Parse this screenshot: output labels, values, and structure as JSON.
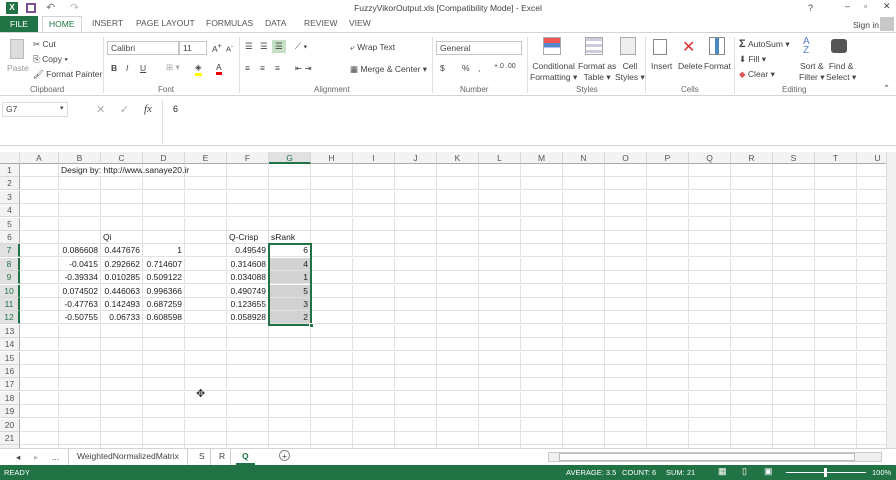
{
  "window": {
    "title": "FuzzyVikorOutput.xls  [Compatibility Mode] - Excel",
    "help": "?",
    "sign_in": "Sign in"
  },
  "tabs": [
    "FILE",
    "HOME",
    "INSERT",
    "PAGE LAYOUT",
    "FORMULAS",
    "DATA",
    "REVIEW",
    "VIEW"
  ],
  "ribbon": {
    "clipboard": {
      "paste": "Paste",
      "cut": "Cut",
      "copy": "Copy",
      "format_painter": "Format Painter",
      "label": "Clipboard"
    },
    "font": {
      "name": "Calibri",
      "size": "11",
      "bold": "B",
      "italic": "I",
      "underline": "U",
      "label": "Font"
    },
    "alignment": {
      "wrap": "Wrap Text",
      "merge": "Merge & Center",
      "label": "Alignment"
    },
    "number": {
      "format": "General",
      "currency": "$",
      "percent": "%",
      "comma": ",",
      "label": "Number"
    },
    "styles": {
      "conditional": "Conditional",
      "conditional2": "Formatting",
      "format_table": "Format as",
      "format_table2": "Table",
      "cell_styles": "Cell",
      "cell_styles2": "Styles",
      "label": "Styles"
    },
    "cells": {
      "insert": "Insert",
      "delete": "Delete",
      "format": "Format",
      "label": "Cells"
    },
    "editing": {
      "autosum": "AutoSum",
      "fill": "Fill",
      "clear": "Clear",
      "sort": "Sort &",
      "sort2": "Filter",
      "find": "Find &",
      "find2": "Select",
      "label": "Editing"
    }
  },
  "formula_bar": {
    "name_box": "G7",
    "fx": "fx",
    "value": "6"
  },
  "columns": [
    "A",
    "B",
    "C",
    "D",
    "E",
    "F",
    "G",
    "H",
    "I",
    "J",
    "K",
    "L",
    "M",
    "N",
    "O",
    "P",
    "Q",
    "R",
    "S",
    "T",
    "U"
  ],
  "row_count": 22,
  "cells": {
    "B1": "Design by: http://www.sanaye20.ir",
    "C6": "Qi",
    "F6": "Q-Crisp",
    "G6": "sRank",
    "B7": "0.086608",
    "C7": "0.447676",
    "D7": "1",
    "F7": "0.49549",
    "G7": "6",
    "B8": "-0.0415",
    "C8": "0.292662",
    "D8": "0.714607",
    "F8": "0.314608",
    "G8": "4",
    "B9": "-0.39334",
    "C9": "0.010285",
    "D9": "0.509122",
    "F9": "0.034088",
    "G9": "1",
    "B10": "0.074502",
    "C10": "0.446063",
    "D10": "0.996366",
    "F10": "0.490749",
    "G10": "5",
    "B11": "-0.47763",
    "C11": "0.142493",
    "D11": "0.687259",
    "F11": "0.123655",
    "G11": "3",
    "B12": "-0.50755",
    "C12": "0.06733",
    "D12": "0.608598",
    "F12": "0.058928",
    "G12": "2"
  },
  "sheets": {
    "ellipsis": "...",
    "tabs": [
      "WeightedNormalizedMatrix",
      "S",
      "R",
      "Q"
    ],
    "active": "Q",
    "add": "+"
  },
  "status": {
    "ready": "READY",
    "average": "AVERAGE: 3.5",
    "count": "COUNT: 6",
    "sum": "SUM: 21",
    "zoom": "100%"
  },
  "colors": {
    "accent": "#217346",
    "selection": "#d2d2d2"
  }
}
